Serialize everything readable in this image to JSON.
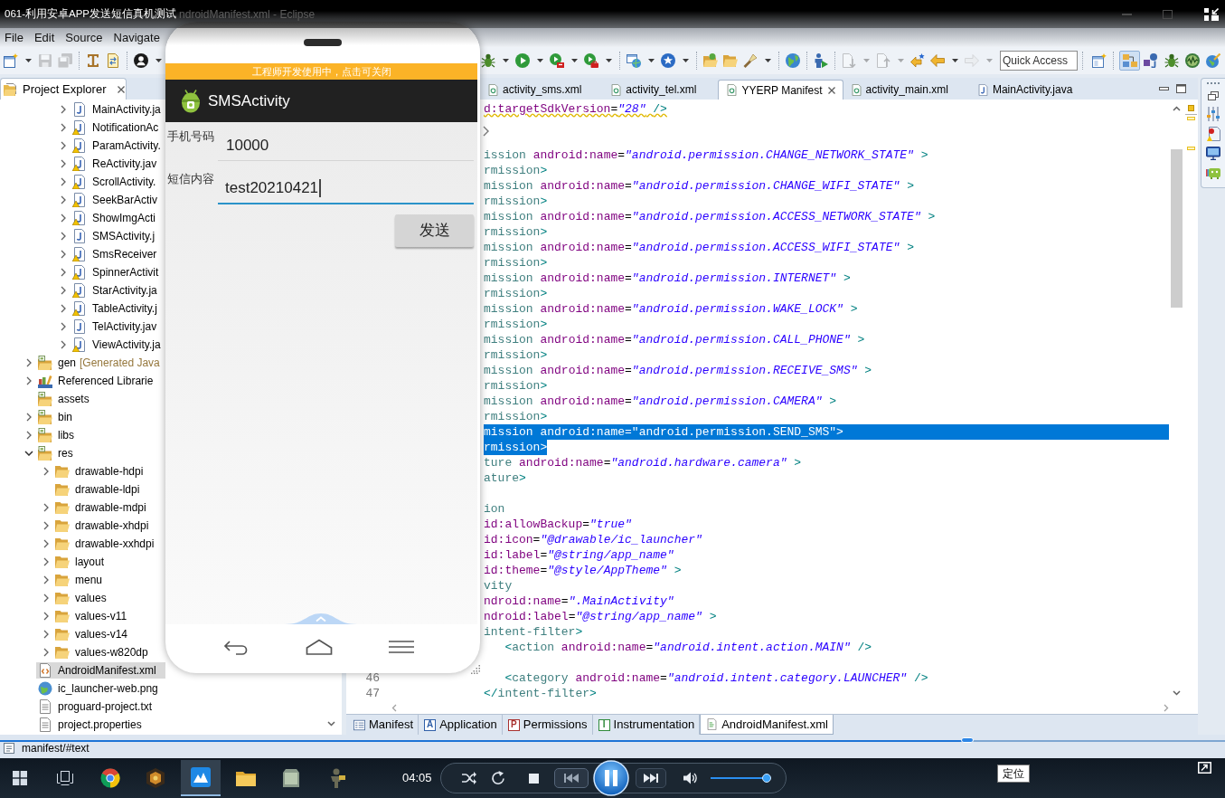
{
  "player_title": "061-利用安卓APP发送短信真机测试",
  "window": {
    "title": "ndroidManifest.xml - Eclipse"
  },
  "menu": [
    "File",
    "Edit",
    "Source",
    "Navigate"
  ],
  "toolbar": {
    "left": [
      {
        "kind": "new_wizard",
        "disabled": false
      },
      {
        "kind": "caret",
        "disabled": false
      },
      {
        "kind": "save",
        "disabled": true
      },
      {
        "kind": "save_all",
        "disabled": true
      },
      {
        "kind": "separator"
      },
      {
        "kind": "i_beam",
        "disabled": false
      },
      {
        "kind": "doc_arrows",
        "disabled": false
      },
      {
        "kind": "separator"
      },
      {
        "kind": "user",
        "disabled": false
      },
      {
        "kind": "caret",
        "disabled": false
      }
    ],
    "right": [
      {
        "kind": "bug",
        "disabled": false
      },
      {
        "kind": "caret",
        "disabled": false
      },
      {
        "kind": "run",
        "disabled": false
      },
      {
        "kind": "caret",
        "disabled": false
      },
      {
        "kind": "run_box",
        "disabled": false
      },
      {
        "kind": "caret",
        "disabled": false
      },
      {
        "kind": "run_case",
        "disabled": false
      },
      {
        "kind": "caret",
        "disabled": false
      },
      {
        "kind": "separator"
      },
      {
        "kind": "window_globe",
        "disabled": false
      },
      {
        "kind": "caret",
        "disabled": false
      },
      {
        "kind": "star_circle",
        "disabled": false
      },
      {
        "kind": "caret",
        "disabled": false
      },
      {
        "kind": "separator"
      },
      {
        "kind": "folder_green",
        "disabled": false
      },
      {
        "kind": "folder",
        "disabled": false
      },
      {
        "kind": "flashlight",
        "disabled": false
      },
      {
        "kind": "caret",
        "disabled": false
      },
      {
        "kind": "separator"
      },
      {
        "kind": "globe",
        "disabled": false
      },
      {
        "kind": "separator"
      },
      {
        "kind": "figure_play",
        "disabled": false
      },
      {
        "kind": "separator"
      },
      {
        "kind": "doc_down",
        "disabled": true
      },
      {
        "kind": "caret",
        "disabled": true
      },
      {
        "kind": "doc_up",
        "disabled": true
      },
      {
        "kind": "caret",
        "disabled": true
      },
      {
        "kind": "arrow_star",
        "disabled": false
      },
      {
        "kind": "arrow_left",
        "disabled": false
      },
      {
        "kind": "caret",
        "disabled": false
      },
      {
        "kind": "arrow_right",
        "disabled": true
      },
      {
        "kind": "caret",
        "disabled": true
      }
    ],
    "quick_access": {
      "placeholder": "Quick Access"
    },
    "perspectives": [
      {
        "kind": "blocks",
        "selected": true
      },
      {
        "kind": "cubes",
        "selected": false
      },
      {
        "kind": "bug",
        "selected": false
      },
      {
        "kind": "wave_circle",
        "selected": false
      },
      {
        "kind": "globe_brush",
        "selected": false
      }
    ]
  },
  "project_explorer": {
    "title": "Project Explorer",
    "tree": [
      {
        "children": [
          {
            "children": [
              {
                "label": "MainActivity.ja",
                "kind": "java",
                "warning": false,
                "expanded": false,
                "selected": false
              },
              {
                "label": "NotificationAc",
                "kind": "java",
                "warning": true,
                "expanded": false,
                "selected": false
              },
              {
                "label": "ParamActivity.",
                "kind": "java",
                "warning": true,
                "expanded": false,
                "selected": false
              },
              {
                "label": "ReActivity.jav",
                "kind": "java",
                "warning": true,
                "expanded": false,
                "selected": false
              },
              {
                "label": "ScrollActivity.",
                "kind": "java",
                "warning": true,
                "expanded": false,
                "selected": false
              },
              {
                "label": "SeekBarActiv",
                "kind": "java",
                "warning": true,
                "expanded": false,
                "selected": false
              },
              {
                "label": "ShowImgActi",
                "kind": "java",
                "warning": true,
                "expanded": false,
                "selected": false
              },
              {
                "label": "SMSActivity.j",
                "kind": "java",
                "warning": false,
                "expanded": false,
                "selected": false
              },
              {
                "label": "SmsReceiver",
                "kind": "java",
                "warning": true,
                "expanded": false,
                "selected": false
              },
              {
                "label": "SpinnerActivit",
                "kind": "java",
                "warning": true,
                "expanded": false,
                "selected": false
              },
              {
                "label": "StarActivity.ja",
                "kind": "java",
                "warning": true,
                "expanded": false,
                "selected": false
              },
              {
                "label": "TableActivity.j",
                "kind": "java",
                "warning": true,
                "expanded": false,
                "selected": false
              },
              {
                "label": "TelActivity.jav",
                "kind": "java",
                "warning": false,
                "expanded": false,
                "selected": false
              },
              {
                "label": "ViewActivity.ja",
                "kind": "java",
                "warning": true,
                "expanded": false,
                "selected": false
              }
            ]
          }
        ]
      },
      {
        "label": "gen",
        "decoration": "[Generated Java",
        "kind": "source_folder",
        "expanded": false,
        "selected": false
      },
      {
        "label": "Referenced Librarie",
        "kind": "library",
        "expanded": false,
        "selected": false
      },
      {
        "label": "assets",
        "kind": "source_folder",
        "selected": false
      },
      {
        "label": "bin",
        "kind": "source_folder",
        "expanded": false,
        "selected": false
      },
      {
        "label": "libs",
        "kind": "source_folder",
        "expanded": false,
        "selected": false
      },
      {
        "label": "res",
        "kind": "source_folder",
        "expanded": true,
        "selected": false,
        "children": [
          {
            "label": "drawable-hdpi",
            "kind": "folder",
            "expanded": false,
            "selected": false
          },
          {
            "label": "drawable-ldpi",
            "kind": "folder",
            "selected": false
          },
          {
            "label": "drawable-mdpi",
            "kind": "folder",
            "expanded": false,
            "selected": false
          },
          {
            "label": "drawable-xhdpi",
            "kind": "folder",
            "expanded": false,
            "selected": false
          },
          {
            "label": "drawable-xxhdpi",
            "kind": "folder",
            "expanded": false,
            "selected": false
          },
          {
            "label": "layout",
            "kind": "folder",
            "expanded": false,
            "selected": false
          },
          {
            "label": "menu",
            "kind": "folder",
            "expanded": false,
            "selected": false
          },
          {
            "label": "values",
            "kind": "folder",
            "expanded": false,
            "selected": false
          },
          {
            "label": "values-v11",
            "kind": "folder",
            "expanded": false,
            "selected": false
          },
          {
            "label": "values-v14",
            "kind": "folder",
            "expanded": false,
            "selected": false
          },
          {
            "label": "values-w820dp",
            "kind": "folder",
            "expanded": false,
            "selected": false
          }
        ]
      },
      {
        "label": "AndroidManifest.xml",
        "kind": "xml_file",
        "selected": true
      },
      {
        "label": "ic_launcher-web.png",
        "kind": "image_file",
        "selected": false
      },
      {
        "label": "proguard-project.txt",
        "kind": "text_file",
        "selected": false
      },
      {
        "label": "project.properties",
        "kind": "text_file",
        "selected": false
      }
    ]
  },
  "editor": {
    "tabs": [
      {
        "label": "activity_sms.xml",
        "kind": "xml",
        "selected": false
      },
      {
        "label": "activity_tel.xml",
        "kind": "xml",
        "selected": false
      },
      {
        "label": "YYERP Manifest",
        "kind": "xml",
        "selected": true
      },
      {
        "label": "activity_main.xml",
        "kind": "xml",
        "selected": false
      },
      {
        "label": "MainActivity.java",
        "kind": "java",
        "selected": false
      }
    ],
    "lines": [
      {
        "text": "d:targetSdkVersion=\"28\" />",
        "selected": false,
        "warning": true
      },
      {
        "selected": false
      },
      {
        "selected": false
      },
      {
        "text": "ission android:name=\"android.permission.CHANGE_NETWORK_STATE\" >",
        "selected": false
      },
      {
        "text": "rmission>",
        "selected": false
      },
      {
        "text": "mission android:name=\"android.permission.CHANGE_WIFI_STATE\" >",
        "selected": false
      },
      {
        "text": "rmission>",
        "selected": false
      },
      {
        "text": "mission android:name=\"android.permission.ACCESS_NETWORK_STATE\" >",
        "selected": false
      },
      {
        "text": "rmission>",
        "selected": false
      },
      {
        "text": "mission android:name=\"android.permission.ACCESS_WIFI_STATE\" >",
        "selected": false
      },
      {
        "text": "rmission>",
        "selected": false
      },
      {
        "text": "mission android:name=\"android.permission.INTERNET\" >",
        "selected": false
      },
      {
        "text": "rmission>",
        "selected": false
      },
      {
        "text": "mission android:name=\"android.permission.WAKE_LOCK\" >",
        "selected": false
      },
      {
        "text": "rmission>",
        "selected": false
      },
      {
        "text": "mission android:name=\"android.permission.CALL_PHONE\" >",
        "selected": false
      },
      {
        "text": "rmission>",
        "selected": false
      },
      {
        "text": "mission android:name=\"android.permission.RECEIVE_SMS\" >",
        "selected": false
      },
      {
        "text": "rmission>",
        "selected": false
      },
      {
        "text": "mission android:name=\"android.permission.CAMERA\" >",
        "selected": false
      },
      {
        "text": "rmission>",
        "selected": false
      },
      {
        "text": "mission android:name=\"android.permission.SEND_SMS\">",
        "selected": true
      },
      {
        "text": "rmission>",
        "selected": true
      },
      {
        "text": "ture android:name=\"android.hardware.camera\" >",
        "selected": false
      },
      {
        "text": "ature>",
        "selected": false
      },
      {
        "selected": false
      },
      {
        "text": "ion",
        "selected": false
      },
      {
        "text": "id:allowBackup=\"true\"",
        "selected": false
      },
      {
        "text": "id:icon=\"@drawable/ic_launcher\"",
        "selected": false
      },
      {
        "text": "id:label=\"@string/app_name\"",
        "selected": false
      },
      {
        "text": "id:theme=\"@style/AppTheme\" >",
        "selected": false
      },
      {
        "text": "vity",
        "selected": false
      },
      {
        "text": "ndroid:name=\".MainActivity\"",
        "selected": false
      },
      {
        "text": "ndroid:label=\"@string/app_name\" >",
        "selected": false
      },
      {
        "text": "intent-filter>",
        "selected": false
      },
      {
        "text": "   <action android:name=\"android.intent.action.MAIN\" />",
        "selected": false
      },
      {
        "selected": false
      },
      {
        "number": "46",
        "text": "   <category android:name=\"android.intent.category.LAUNCHER\" />",
        "selected": false
      },
      {
        "number": "47",
        "text": "</intent-filter>",
        "selected": false
      }
    ],
    "bottom_tabs": [
      {
        "label": "Manifest",
        "kind": "form",
        "selected": false
      },
      {
        "label": "Application",
        "kind": "letter",
        "badge": "A",
        "color": "#2f5fa8",
        "selected": false
      },
      {
        "label": "Permissions",
        "kind": "letter",
        "badge": "P",
        "color": "#a8312f",
        "selected": false
      },
      {
        "label": "Instrumentation",
        "kind": "letter",
        "badge": "I",
        "color": "#2f8a3a",
        "selected": false
      },
      {
        "label": "AndroidManifest.xml",
        "kind": "source",
        "selected": true
      }
    ]
  },
  "status_bar": {
    "text": "manifest/#text"
  },
  "phone": {
    "banner": "工程师开发使用中，点击可关闭",
    "app_title": "SMSActivity",
    "fields": [
      {
        "label": "手机号码",
        "value": "10000",
        "focused": false
      },
      {
        "label": "短信内容",
        "value": "test20210421",
        "focused": true
      }
    ],
    "button": "发送"
  },
  "taskbar": [
    {
      "kind": "start",
      "selected": false
    },
    {
      "kind": "task_view",
      "selected": false
    },
    {
      "kind": "browser",
      "selected": false
    },
    {
      "kind": "emblem",
      "selected": false
    },
    {
      "kind": "mountain",
      "selected": true
    },
    {
      "kind": "folder",
      "selected": false
    },
    {
      "kind": "tablet",
      "selected": false
    },
    {
      "kind": "figure",
      "selected": false
    }
  ],
  "player": {
    "seek": {
      "level": 0.79
    },
    "tooltip": "定位",
    "time": "04:05",
    "playing": true,
    "volume": {
      "level": 0.96
    }
  }
}
